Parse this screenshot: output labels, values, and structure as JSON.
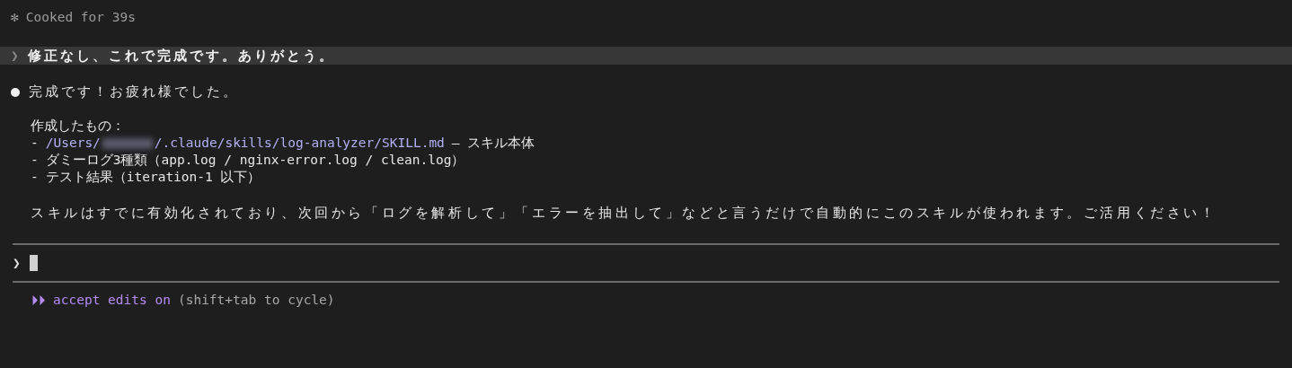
{
  "status_line": {
    "icon": "✻",
    "text": "Cooked for 39s"
  },
  "user_message": {
    "prompt": "❯",
    "text": "修正なし、これで完成です。ありがとう。"
  },
  "response": {
    "heading": "完成です！お疲れ様でした。",
    "list_title": "作成したもの：",
    "items": [
      {
        "kind": "path",
        "dash": "-",
        "path_head": "/Users/",
        "redacted": true,
        "path_tail": "/.claude/skills/log-analyzer/SKILL.md",
        "text": "– スキル本体"
      },
      {
        "kind": "plain",
        "dash": "-",
        "text": "ダミーログ3種類（app.log / nginx-error.log / clean.log）"
      },
      {
        "kind": "plain",
        "dash": "-",
        "text": "テスト結果（iteration-1 以下）"
      }
    ],
    "summary": "スキルはすでに有効化されており、次回から「ログを解析して」「エラーを抽出して」などと言うだけで自動的にこのスキルが使われます。ご活用ください！"
  },
  "input": {
    "prompt": "❯"
  },
  "mode_bar": {
    "icon": "⏵⏵",
    "label": "accept edits on",
    "hint": "(shift+tab to cycle)"
  }
}
